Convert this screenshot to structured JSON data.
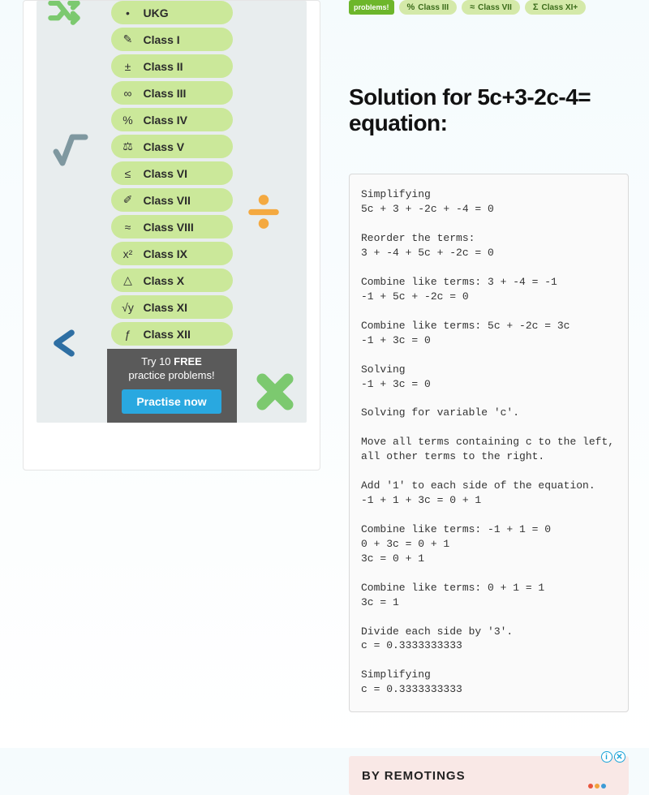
{
  "sidebar": {
    "items": [
      {
        "icon": "•",
        "label": "UKG"
      },
      {
        "icon": "✎",
        "label": "Class I"
      },
      {
        "icon": "±",
        "label": "Class II"
      },
      {
        "icon": "∞",
        "label": "Class III"
      },
      {
        "icon": "%",
        "label": "Class IV"
      },
      {
        "icon": "⚖",
        "label": "Class V"
      },
      {
        "icon": "≤",
        "label": "Class VI"
      },
      {
        "icon": "✐",
        "label": "Class VII"
      },
      {
        "icon": "≈",
        "label": "Class VIII"
      },
      {
        "icon": "x²",
        "label": "Class IX"
      },
      {
        "icon": "△",
        "label": "Class X"
      },
      {
        "icon": "√y",
        "label": "Class XI"
      },
      {
        "icon": "ƒ",
        "label": "Class XII"
      }
    ],
    "cta_line1": "Try 10 ",
    "cta_bold": "FREE",
    "cta_line2": "practice problems!",
    "cta_button": "Practise now"
  },
  "top_tags": {
    "solid": "problems!",
    "items": [
      {
        "sym": "%",
        "label": "Class III"
      },
      {
        "sym": "≈",
        "label": "Class VII"
      },
      {
        "sym": "Σ",
        "label": "Class XI+"
      }
    ]
  },
  "solution": {
    "title": "Solution for 5c+3-2c-4= equation:",
    "text": "Simplifying\n5c + 3 + -2c + -4 = 0\n\nReorder the terms:\n3 + -4 + 5c + -2c = 0\n\nCombine like terms: 3 + -4 = -1\n-1 + 5c + -2c = 0\n\nCombine like terms: 5c + -2c = 3c\n-1 + 3c = 0\n\nSolving\n-1 + 3c = 0\n\nSolving for variable 'c'.\n\nMove all terms containing c to the left, all other terms to the right.\n\nAdd '1' to each side of the equation.\n-1 + 1 + 3c = 0 + 1\n\nCombine like terms: -1 + 1 = 0\n0 + 3c = 0 + 1\n3c = 0 + 1\n\nCombine like terms: 0 + 1 = 1\n3c = 1\n\nDivide each side by '3'.\nc = 0.3333333333\n\nSimplifying\nc = 0.3333333333"
  },
  "promo": {
    "label": "BY REMOTINGS",
    "info": "i",
    "close": "✕",
    "logo_colors": [
      "#e8553e",
      "#f0a23c",
      "#3d9bd6"
    ]
  }
}
